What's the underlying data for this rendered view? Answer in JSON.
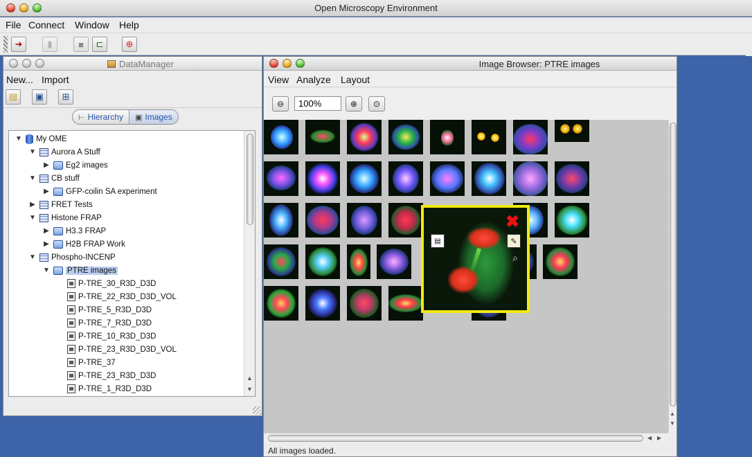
{
  "app": {
    "title": "Open Microscopy Environment",
    "menu": [
      "File",
      "Connect",
      "Window",
      "Help"
    ]
  },
  "data_manager": {
    "title": "DataManager",
    "menu": [
      "New...",
      "Import"
    ],
    "tabs": [
      "Hierarchy",
      "Images"
    ],
    "tree": [
      {
        "label": "My OME",
        "level": 0,
        "kind": "db",
        "expanded": true
      },
      {
        "label": "Aurora A Stuff",
        "level": 1,
        "kind": "project",
        "expanded": true
      },
      {
        "label": "Eg2 images",
        "level": 2,
        "kind": "dataset",
        "expanded": false
      },
      {
        "label": "CB stuff",
        "level": 1,
        "kind": "project",
        "expanded": true
      },
      {
        "label": "GFP-coilin SA experiment",
        "level": 2,
        "kind": "dataset",
        "expanded": false
      },
      {
        "label": "FRET Tests",
        "level": 1,
        "kind": "project",
        "expanded": false
      },
      {
        "label": "Histone FRAP",
        "level": 1,
        "kind": "project",
        "expanded": true
      },
      {
        "label": "H3.3 FRAP",
        "level": 2,
        "kind": "dataset",
        "expanded": false
      },
      {
        "label": "H2B FRAP Work",
        "level": 2,
        "kind": "dataset",
        "expanded": false
      },
      {
        "label": "Phospho-INCENP",
        "level": 1,
        "kind": "project",
        "expanded": true
      },
      {
        "label": "PTRE images",
        "level": 2,
        "kind": "dataset",
        "expanded": true,
        "selected": true
      },
      {
        "label": "P-TRE_30_R3D_D3D",
        "level": 3,
        "kind": "image"
      },
      {
        "label": "P-TRE_22_R3D_D3D_VOL",
        "level": 3,
        "kind": "image"
      },
      {
        "label": "P-TRE_5_R3D_D3D",
        "level": 3,
        "kind": "image"
      },
      {
        "label": "P-TRE_7_R3D_D3D",
        "level": 3,
        "kind": "image"
      },
      {
        "label": "P-TRE_10_R3D_D3D",
        "level": 3,
        "kind": "image"
      },
      {
        "label": "P-TRE_23_R3D_D3D_VOL",
        "level": 3,
        "kind": "image"
      },
      {
        "label": "P-TRE_37",
        "level": 3,
        "kind": "image"
      },
      {
        "label": "P-TRE_23_R3D_D3D",
        "level": 3,
        "kind": "image"
      },
      {
        "label": "P-TRE_1_R3D_D3D",
        "level": 3,
        "kind": "image"
      }
    ]
  },
  "image_browser": {
    "title": "Image Browser: PTRE images",
    "menu": [
      "View",
      "Analyze",
      "Layout"
    ],
    "zoom": "100%",
    "status": "All images loaded."
  },
  "colors": {
    "desktop": "#3d64a8",
    "selection": "#b9cdf0",
    "popup_border": "#f2ea12"
  }
}
